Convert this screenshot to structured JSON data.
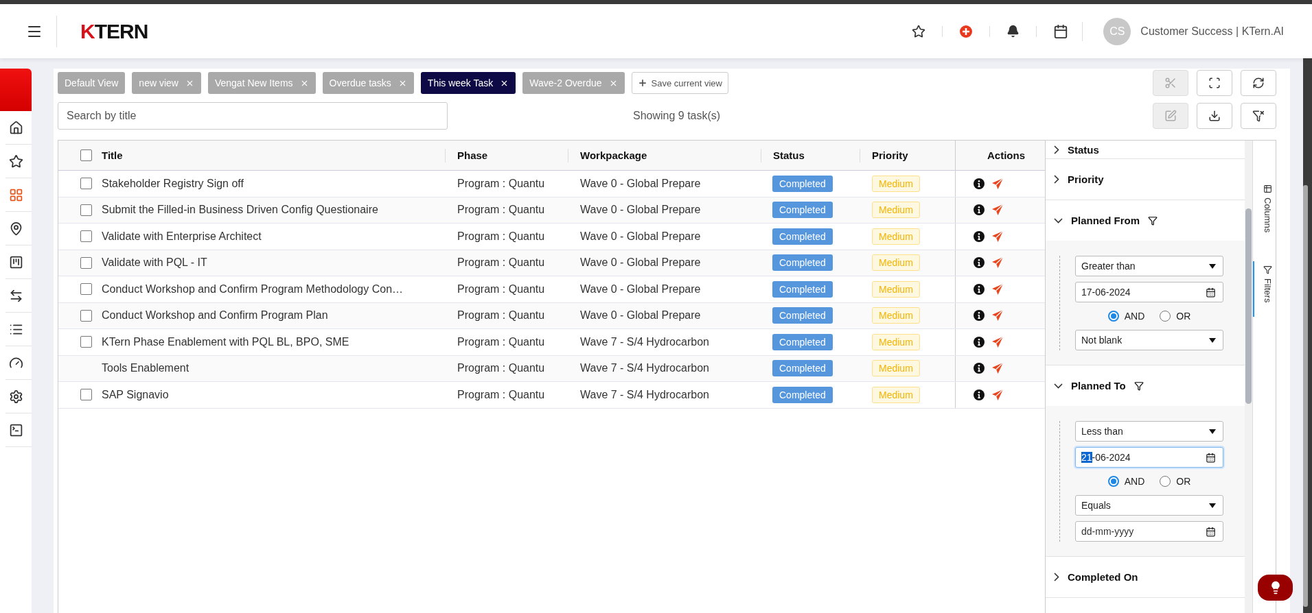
{
  "header": {
    "logo": {
      "mark": "K",
      "text": "TERN"
    },
    "actions": [
      {
        "kind": "star"
      },
      {
        "kind": "add"
      },
      {
        "kind": "bell"
      },
      {
        "kind": "calendar"
      }
    ],
    "user": {
      "initials": "CS",
      "name": "Customer Success | KTern.AI"
    }
  },
  "sidebar": {
    "items": [
      {
        "kind": "home",
        "selected": false
      },
      {
        "kind": "star",
        "selected": false
      },
      {
        "kind": "grid",
        "selected": true
      },
      {
        "kind": "pin",
        "selected": false
      },
      {
        "kind": "board",
        "selected": false
      },
      {
        "kind": "swap",
        "selected": false
      },
      {
        "kind": "list",
        "selected": false
      },
      {
        "kind": "gauge",
        "selected": false
      },
      {
        "kind": "settings",
        "selected": false
      },
      {
        "kind": "terminal",
        "selected": false
      }
    ]
  },
  "views": [
    {
      "label": "Default View",
      "selected": false,
      "closable": false
    },
    {
      "label": "new view",
      "selected": false,
      "closable": true
    },
    {
      "label": "Vengat New Items",
      "selected": false,
      "closable": true
    },
    {
      "label": "Overdue tasks",
      "selected": false,
      "closable": true
    },
    {
      "label": "This week Task",
      "selected": true,
      "closable": true
    },
    {
      "label": "Wave-2 Overdue",
      "selected": false,
      "closable": true
    }
  ],
  "save_view": "Save current view",
  "view_tools": [
    {
      "kind": "cut",
      "disabled": true
    },
    {
      "kind": "fullscreen",
      "disabled": false
    },
    {
      "kind": "refresh",
      "disabled": false
    }
  ],
  "search": {
    "placeholder": "Search by title"
  },
  "task_count": "Showing 9 task(s)",
  "table_tools": [
    {
      "kind": "edit",
      "disabled": true
    },
    {
      "kind": "download",
      "disabled": false
    },
    {
      "kind": "clear-filter",
      "disabled": false
    }
  ],
  "table": {
    "all_checked": false,
    "columns": [
      "Title",
      "Phase",
      "Workpackage",
      "Status",
      "Priority",
      "Actions"
    ],
    "rows": [
      {
        "checked": false,
        "title": "Stakeholder Registry Sign off",
        "phase": "Program : Quantu",
        "workpackage": "Wave 0 - Global Prepare",
        "status": "Completed",
        "priority": "Medium"
      },
      {
        "checked": false,
        "title": "Submit the Filled-in Business Driven Config Questionaire",
        "phase": "Program : Quantu",
        "workpackage": "Wave 0 - Global Prepare",
        "status": "Completed",
        "priority": "Medium"
      },
      {
        "checked": false,
        "title": "Validate with Enterprise Architect",
        "phase": "Program : Quantu",
        "workpackage": "Wave 0 - Global Prepare",
        "status": "Completed",
        "priority": "Medium"
      },
      {
        "checked": false,
        "title": "Validate with PQL - IT",
        "phase": "Program : Quantu",
        "workpackage": "Wave 0 - Global Prepare",
        "status": "Completed",
        "priority": "Medium"
      },
      {
        "checked": false,
        "title": "Conduct Workshop and Confirm Program Methodology Con…",
        "phase": "Program : Quantu",
        "workpackage": "Wave 0 - Global Prepare",
        "status": "Completed",
        "priority": "Medium"
      },
      {
        "checked": false,
        "title": "Conduct Workshop and Confirm Program Plan",
        "phase": "Program : Quantu",
        "workpackage": "Wave 0 - Global Prepare",
        "status": "Completed",
        "priority": "Medium"
      },
      {
        "checked": false,
        "title": "KTern Phase Enablement with PQL BL, BPO, SME",
        "phase": "Program : Quantu",
        "workpackage": "Wave 7 - S/4 Hydrocarbon",
        "status": "Completed",
        "priority": "Medium"
      },
      {
        "title": "Tools Enablement",
        "phase": "Program : Quantu",
        "workpackage": "Wave 7 - S/4 Hydrocarbon",
        "status": "Completed",
        "priority": "Medium"
      },
      {
        "checked": false,
        "title": "SAP Signavio",
        "phase": "Program : Quantu",
        "workpackage": "Wave 7 - S/4 Hydrocarbon",
        "status": "Completed",
        "priority": "Medium"
      }
    ]
  },
  "filter_panel": {
    "sections": [
      {
        "title": "Status",
        "expanded": false,
        "active": false
      },
      {
        "title": "Priority",
        "expanded": false,
        "active": false
      },
      {
        "title": "Planned From",
        "expanded": true,
        "active": true,
        "operator": "Greater than",
        "date": {
          "focused": false,
          "segments": [
            {
              "text": "17-06-2024",
              "selected": false
            }
          ]
        },
        "joins": [
          {
            "label": "AND",
            "selected": true
          },
          {
            "label": "OR",
            "selected": false
          }
        ],
        "operator2": "Not blank"
      },
      {
        "title": "Planned To",
        "expanded": true,
        "active": true,
        "operator": "Less than",
        "date": {
          "focused": true,
          "segments": [
            {
              "text": "21",
              "selected": true
            },
            {
              "text": "-06-2024",
              "selected": false
            }
          ]
        },
        "joins": [
          {
            "label": "AND",
            "selected": true
          },
          {
            "label": "OR",
            "selected": false
          }
        ],
        "operator2": "Equals",
        "date2": {
          "placeholder": "dd-mm-yyyy"
        }
      },
      {
        "title": "Completed On",
        "expanded": false,
        "active": false
      }
    ]
  },
  "side_tabs": [
    {
      "kind": "columns",
      "label": "Columns",
      "selected": false
    },
    {
      "kind": "filters",
      "label": "Filters",
      "selected": true
    }
  ]
}
